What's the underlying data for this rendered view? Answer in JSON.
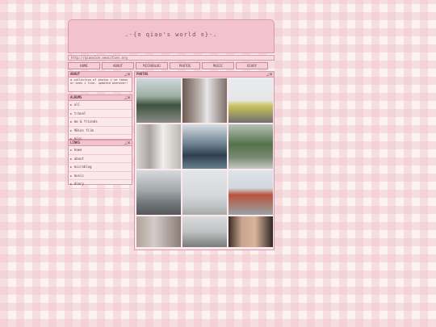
{
  "header": {
    "title": ".·{ɞ qiao's world ɞ}·."
  },
  "url": "http://qiaoxion.neocities.org",
  "nav": [
    "HOME",
    "ABOUT",
    "MICROBLOG",
    "PHOTOS",
    "MUSIC",
    "DIARY"
  ],
  "controls": "_□x",
  "about": {
    "title": "ABOUT",
    "text": "a collection of photos i've taken or ones i like. updated whenever!"
  },
  "albums": {
    "title": "ALBUMS",
    "items": [
      "all",
      "travel",
      "me & friends",
      "90ies film",
      "misc"
    ]
  },
  "links": {
    "title": "LINKS",
    "items": [
      "home",
      "about",
      "microblog",
      "music",
      "diary"
    ]
  },
  "photos": {
    "title": "PHOTOS"
  },
  "colors": {
    "accent": "#f2c3cf",
    "border": "#d79aaa",
    "text": "#5a3a48"
  }
}
